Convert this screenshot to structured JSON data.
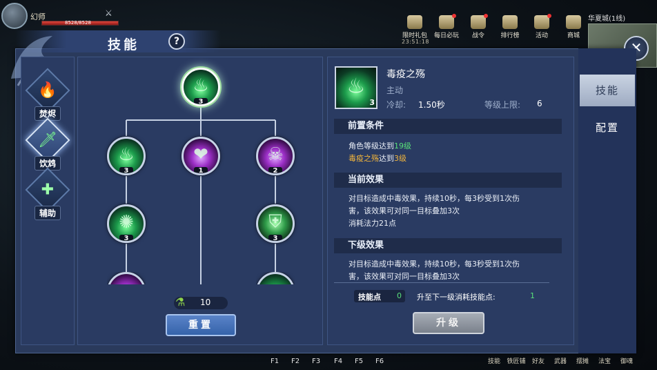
{
  "hud": {
    "player_name": "幻师",
    "hp_text": "8528/8528",
    "top_menu": [
      {
        "label": "限时礼包",
        "icon": "gift-icon"
      },
      {
        "label": "每日必玩",
        "icon": "daily-icon"
      },
      {
        "label": "战令",
        "icon": "battle-pass-icon"
      },
      {
        "label": "排行榜",
        "icon": "ranking-icon"
      },
      {
        "label": "活动",
        "icon": "event-icon"
      },
      {
        "label": "商城",
        "icon": "shop-icon"
      }
    ],
    "timer": "23:51:18",
    "server": "华夏城(1线)",
    "fkeys": [
      "F1",
      "F2",
      "F3",
      "F4",
      "F5",
      "F6"
    ],
    "bottom_menu": [
      "技能",
      "铁匠铺",
      "好友",
      "武器",
      "摆摊",
      "法宝",
      "御魂"
    ]
  },
  "window": {
    "title": "技能",
    "help": "?",
    "close": "✕"
  },
  "schools": [
    {
      "label": "焚烬",
      "glyph": "🔥",
      "active": false
    },
    {
      "label": "饮鸩",
      "glyph": "🗡",
      "active": true
    },
    {
      "label": "辅助",
      "glyph": "✚",
      "active": false
    }
  ],
  "tree": {
    "nodes": [
      {
        "name": "root",
        "level": "3"
      },
      {
        "name": "left-1",
        "level": "3"
      },
      {
        "name": "mid-1",
        "level": "1"
      },
      {
        "name": "right-1",
        "level": "2"
      },
      {
        "name": "left-2",
        "level": "3"
      },
      {
        "name": "right-2",
        "level": "3"
      }
    ],
    "skill_points": "10",
    "reset_label": "重置"
  },
  "detail": {
    "icon_level": "3",
    "name": "毒疫之殇",
    "type": "主动",
    "cooldown_label": "冷却:",
    "cooldown_value": "1.50秒",
    "level_cap_label": "等级上限:",
    "level_cap_value": "6",
    "prereq_header": "前置条件",
    "prereq_1_prefix": "角色等级达到",
    "prereq_1_value": "19级",
    "prereq_2_skill": "毒疫之殇",
    "prereq_2_mid": "达到",
    "prereq_2_value": "3级",
    "current_header": "当前效果",
    "current_text_1": "对目标造成中毒效果，持续10秒，每3秒受到1次伤",
    "current_text_2": "害，该效果可对同一目标叠加3次",
    "current_text_3": "消耗法力21点",
    "next_header": "下级效果",
    "next_text_1": "对目标造成中毒效果，持续10秒，每3秒受到1次伤",
    "next_text_2": "害，该效果可对同一目标叠加3次",
    "sp_label": "技能点",
    "sp_value": "0",
    "upgrade_cost_label": "升至下一级消耗技能点:",
    "upgrade_cost_value": "1",
    "upgrade_button": "升级"
  },
  "tabs": [
    {
      "label": "技能",
      "active": true
    },
    {
      "label": "配置",
      "active": false
    }
  ],
  "colors": {
    "panel": "#2a3b62",
    "highlight_green": "#59e07a",
    "highlight_gold": "#f2b53c"
  }
}
